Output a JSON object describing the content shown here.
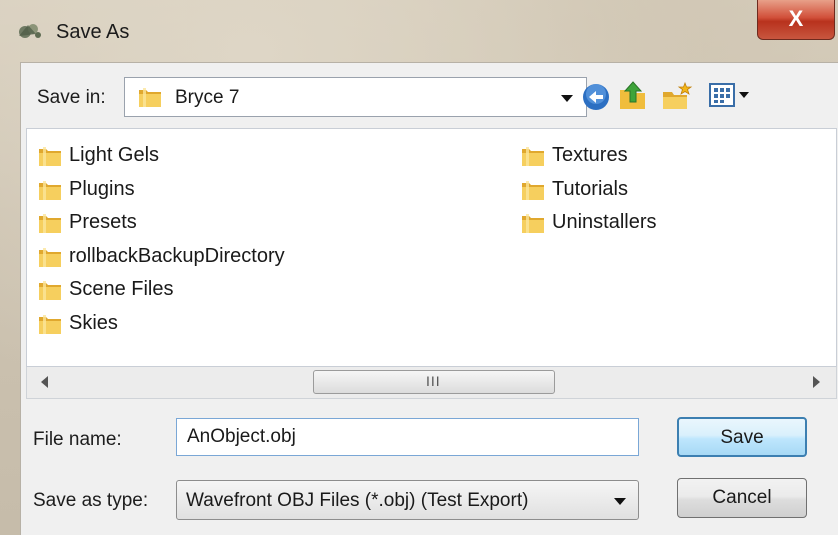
{
  "window": {
    "title": "Save As",
    "close_glyph": "X",
    "app_icon": "dialog-icon"
  },
  "save_in": {
    "label": "Save in:",
    "value": "Bryce 7",
    "icon": "folder-icon"
  },
  "toolbar": {
    "back_icon": "back-icon",
    "up_icon": "up-folder-icon",
    "new_folder_icon": "new-folder-icon",
    "views_icon": "views-menu-icon"
  },
  "files": {
    "left_column": [
      "Light Gels",
      "Plugins",
      "Presets",
      "rollbackBackupDirectory",
      "Scene Files",
      "Skies"
    ],
    "right_column": [
      "Textures",
      "Tutorials",
      "Uninstallers"
    ]
  },
  "scrollbar": {
    "grip": "III"
  },
  "file_name": {
    "label": "File name:",
    "value": "AnObject.obj"
  },
  "save_as_type": {
    "label": "Save as type:",
    "value": "Wavefront OBJ Files (*.obj) (Test Export)"
  },
  "buttons": {
    "save": "Save",
    "cancel": "Cancel"
  },
  "colors": {
    "folder_yellow": "#f2c34e",
    "close_red": "#c8402b",
    "save_border": "#3c7fb1"
  }
}
